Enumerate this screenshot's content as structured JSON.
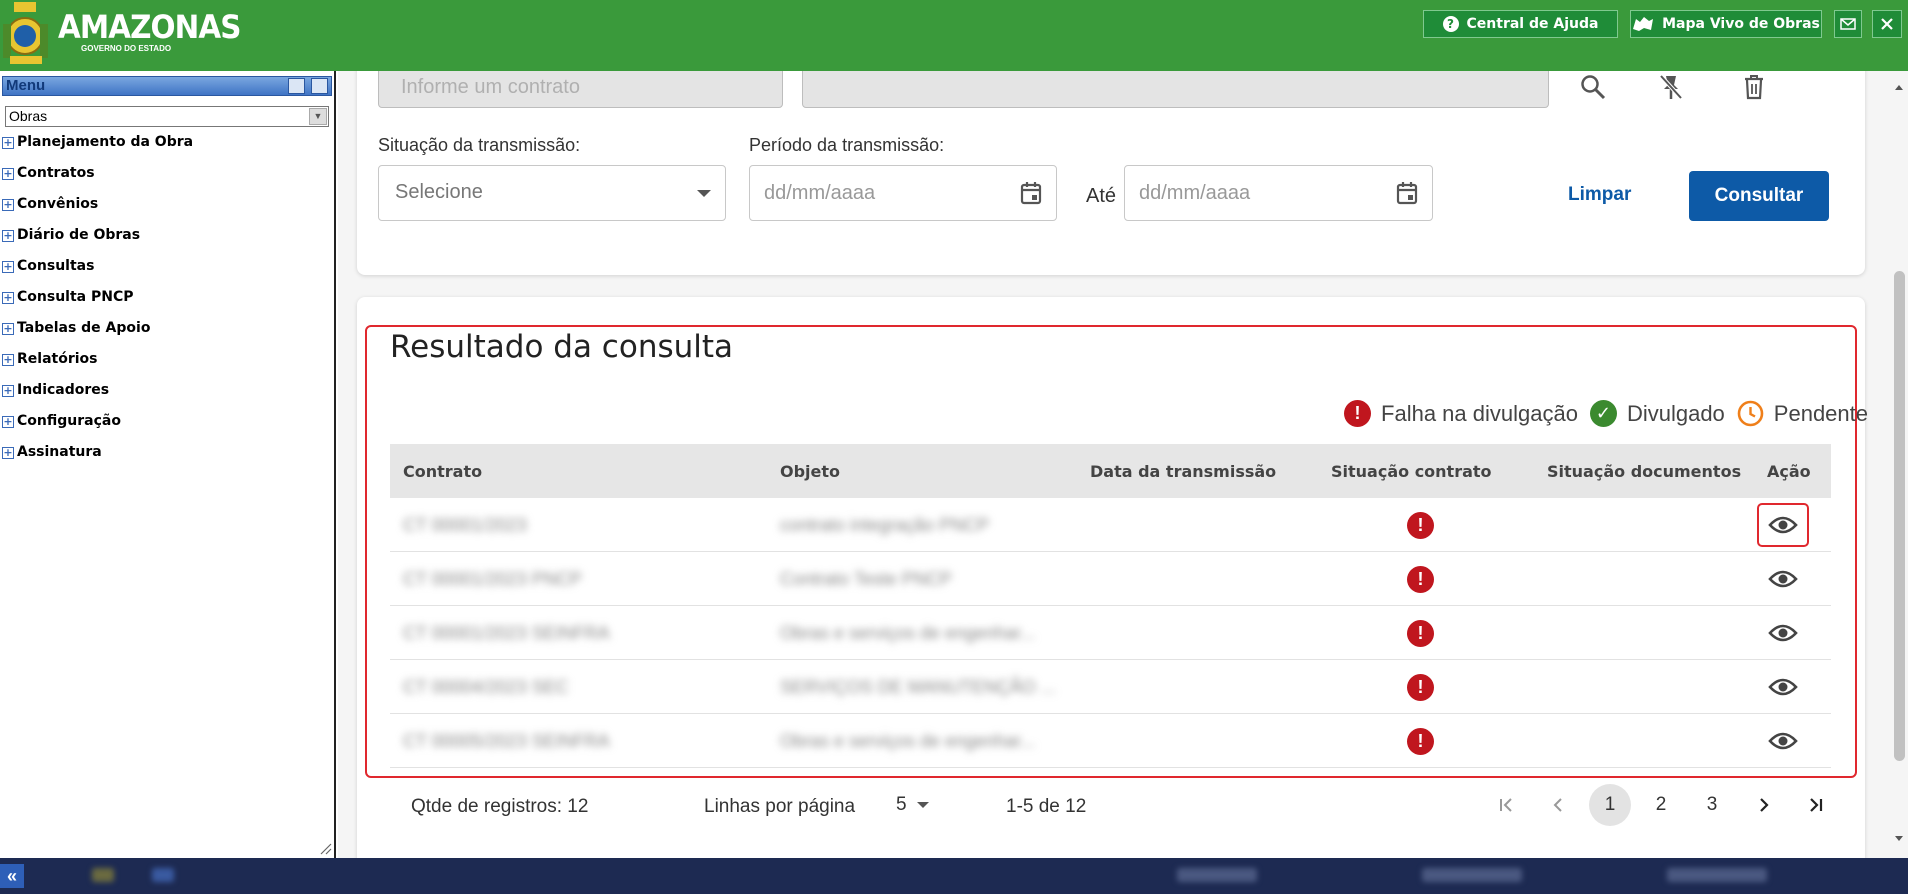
{
  "header": {
    "logo_title": "AMAZONAS",
    "logo_subtitle": "GOVERNO DO ESTADO",
    "help_label": "Central de Ajuda",
    "map_label": "Mapa Vivo de Obras"
  },
  "sidebar": {
    "title": "Menu",
    "module": "Obras",
    "items": [
      "Planejamento da Obra",
      "Contratos",
      "Convênios",
      "Diário de Obras",
      "Consultas",
      "Consulta PNCP",
      "Tabelas de Apoio",
      "Relatórios",
      "Indicadores",
      "Configuração",
      "Assinatura"
    ]
  },
  "filters": {
    "contract_placeholder": "Informe um contrato",
    "status_label": "Situação da transmissão:",
    "status_placeholder": "Selecione",
    "period_label": "Período da transmissão:",
    "date_placeholder": "dd/mm/aaaa",
    "until_label": "Até",
    "clear_label": "Limpar",
    "search_label": "Consultar"
  },
  "results": {
    "title": "Resultado da consulta",
    "legend": {
      "fail": "Falha na divulgação",
      "ok": "Divulgado",
      "pending": "Pendente"
    },
    "columns": {
      "contract": "Contrato",
      "object": "Objeto",
      "date": "Data da transmissão",
      "contract_status": "Situação contrato",
      "docs_status": "Situação documentos",
      "action": "Ação"
    },
    "rows": [
      {
        "contract": "CT 00001/2023",
        "object": "contrato integração PNCP"
      },
      {
        "contract": "CT 00001/2023 PNCP",
        "object": "Contrato Teste PNCP"
      },
      {
        "contract": "CT 00001/2023 SEINFRA",
        "object": "Obras e serviços de engenhar..."
      },
      {
        "contract": "CT 00004/2023 SEC",
        "object": "SERVIÇOS DE MANUTENÇÃO ..."
      },
      {
        "contract": "CT 00005/2023 SEINFRA",
        "object": "Obras e serviços de engenhar..."
      }
    ]
  },
  "pager": {
    "count_label": "Qtde de registros: 12",
    "rows_label": "Linhas por página",
    "rows_value": "5",
    "range_label": "1-5 de 12",
    "pages": [
      "1",
      "2",
      "3"
    ]
  },
  "colors": {
    "header_green": "#3a9a3b",
    "primary_blue": "#0d5aa7",
    "error_red": "#c0161e",
    "ok_green": "#3b8a2f",
    "pending_orange": "#ef7f1a"
  }
}
